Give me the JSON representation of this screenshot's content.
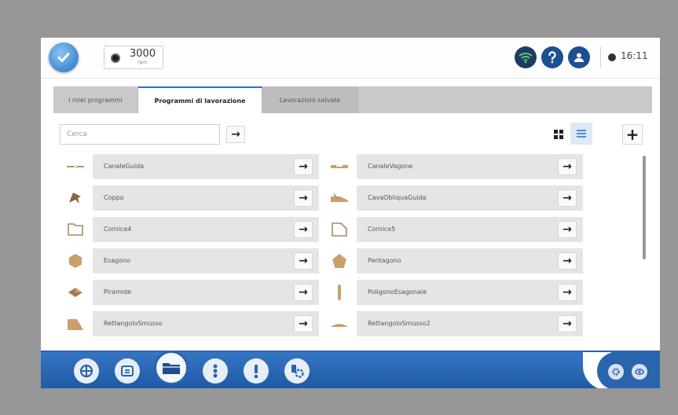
{
  "header": {
    "rpm_value": "3000",
    "rpm_unit": "rpm",
    "time": "16:11"
  },
  "tabs": [
    {
      "label": "I miei programmi"
    },
    {
      "label": "Programmi di lavorazione"
    },
    {
      "label": "Lavorazioni salvate"
    }
  ],
  "search": {
    "placeholder": "Cerca",
    "go_label": "→"
  },
  "toolbar": {
    "add_label": "+"
  },
  "programs": [
    {
      "name": "CanaleGuida",
      "icon": "canale-guida-icon",
      "go": "→"
    },
    {
      "name": "CanaleVagone",
      "icon": "canale-vagone-icon",
      "go": "→"
    },
    {
      "name": "Coppo",
      "icon": "coppo-icon",
      "go": "→"
    },
    {
      "name": "CavaObliquaGuida",
      "icon": "cava-obliqua-guida-icon",
      "go": "→"
    },
    {
      "name": "Cornice4",
      "icon": "cornice4-icon",
      "go": "→"
    },
    {
      "name": "Cornice5",
      "icon": "cornice5-icon",
      "go": "→"
    },
    {
      "name": "Esagono",
      "icon": "esagono-icon",
      "go": "→"
    },
    {
      "name": "Pentagono",
      "icon": "pentagono-icon",
      "go": "→"
    },
    {
      "name": "Piramide",
      "icon": "piramide-icon",
      "go": "→"
    },
    {
      "name": "PoligonoEsagonale",
      "icon": "poligono-esagonale-icon",
      "go": "→"
    },
    {
      "name": "RettangoloSmusso",
      "icon": "rettangolo-smusso-icon",
      "go": "→"
    },
    {
      "name": "RettangoloSmusso2",
      "icon": "rettangolo-smusso2-icon",
      "go": "→"
    }
  ],
  "colors": {
    "accent": "#2a72c0",
    "dock": "#2a64ad",
    "wood": "#c9a06a"
  }
}
